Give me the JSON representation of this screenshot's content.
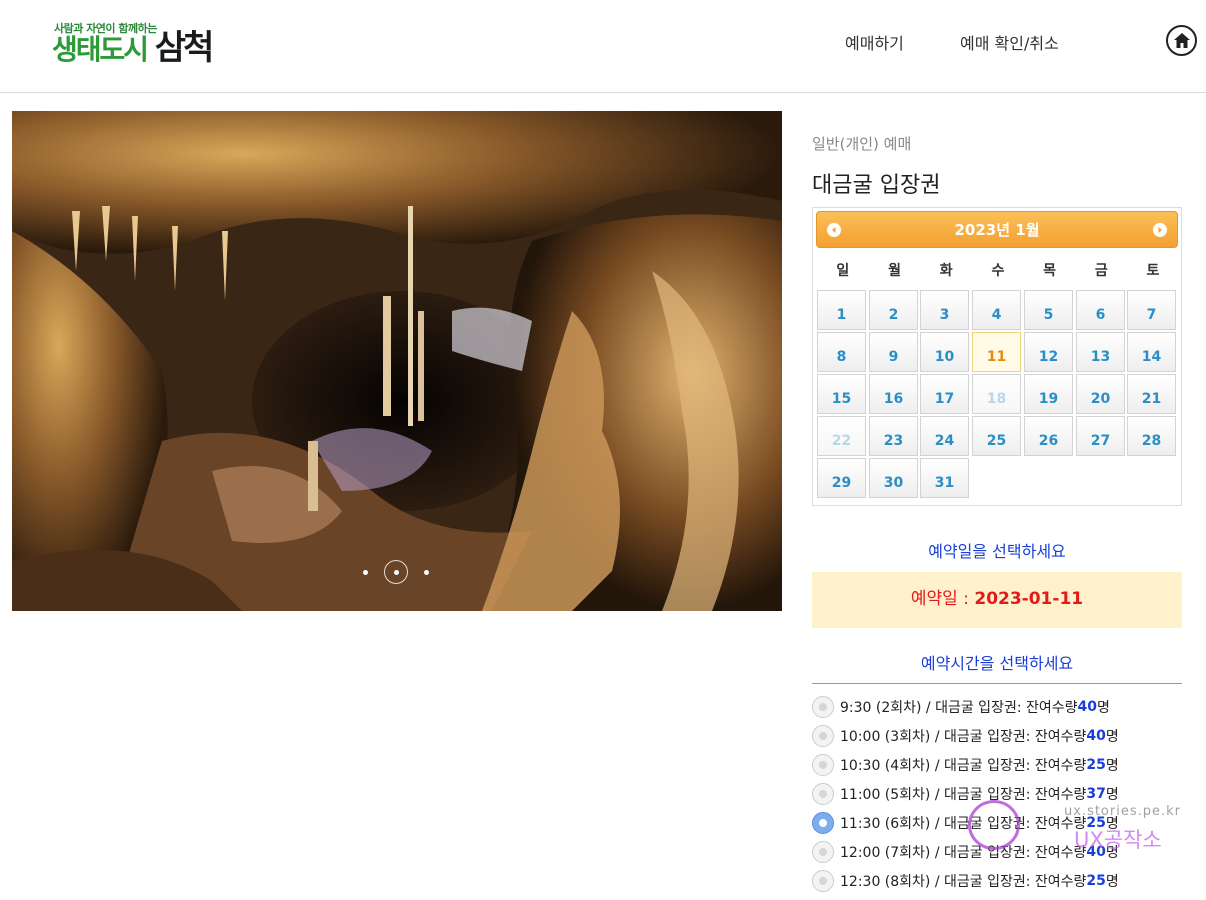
{
  "header": {
    "logo_tagline": "사람과 자연이 함께하는",
    "logo_text_green": "생태도시",
    "logo_text_dark": "삼척",
    "nav": [
      "예매하기",
      "예매 확인/취소"
    ],
    "home_icon": "home-icon"
  },
  "hero": {
    "slide_count": 3,
    "active_slide": 2
  },
  "product": {
    "subtitle": "일반(개인) 예매",
    "title": "대금굴 입장권"
  },
  "calendar": {
    "month_title": "2023년 1월",
    "weekdays": [
      "일",
      "월",
      "화",
      "수",
      "목",
      "금",
      "토"
    ],
    "today": 11,
    "disabled_days": [
      18,
      22
    ],
    "days_in_month": 31,
    "first_weekday": 0,
    "colors": {
      "header": "#f3a032",
      "day_text": "#2b8fc6",
      "today_text": "#e38b12"
    }
  },
  "reservation": {
    "date_prompt": "예약일을 선택하세요",
    "selected_label": "예약일 : ",
    "selected_date": "2023-01-11",
    "time_prompt": "예약시간을 선택하세요",
    "slots": [
      {
        "time": "9:30",
        "session": "(2회차)",
        "product": "대금굴 입장권",
        "remain_label": "잔여수량",
        "count": "40",
        "unit": "명",
        "checked": false
      },
      {
        "time": "10:00",
        "session": "(3회차)",
        "product": "대금굴 입장권",
        "remain_label": "잔여수량",
        "count": "40",
        "unit": "명",
        "checked": false
      },
      {
        "time": "10:30",
        "session": "(4회차)",
        "product": "대금굴 입장권",
        "remain_label": "잔여수량",
        "count": "25",
        "unit": "명",
        "checked": false
      },
      {
        "time": "11:00",
        "session": "(5회차)",
        "product": "대금굴 입장권",
        "remain_label": "잔여수량",
        "count": "37",
        "unit": "명",
        "checked": false
      },
      {
        "time": "11:30",
        "session": "(6회차)",
        "product": "대금굴 입장권",
        "remain_label": "잔여수량",
        "count": "25",
        "unit": "명",
        "checked": true
      },
      {
        "time": "12:00",
        "session": "(7회차)",
        "product": "대금굴 입장권",
        "remain_label": "잔여수량",
        "count": "40",
        "unit": "명",
        "checked": false
      },
      {
        "time": "12:30",
        "session": "(8회차)",
        "product": "대금굴 입장권",
        "remain_label": "잔여수량",
        "count": "25",
        "unit": "명",
        "checked": false
      }
    ]
  },
  "watermark": {
    "url": "ux.stories.pe.kr",
    "name": "UX공작소"
  }
}
